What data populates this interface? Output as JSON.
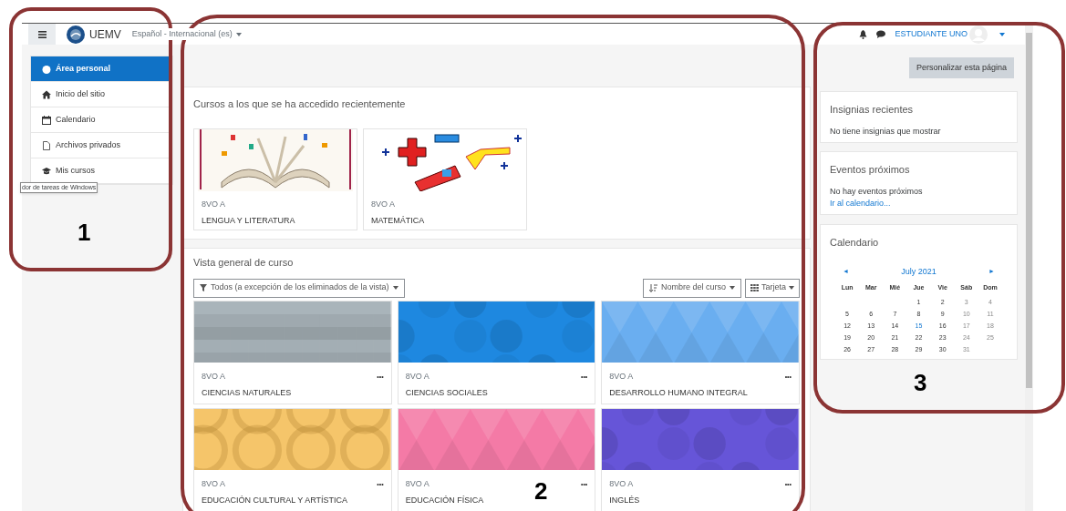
{
  "navbar": {
    "site_name": "UEMV",
    "language": "Español - Internacional (es)",
    "user_name": "ESTUDIANTE UNO"
  },
  "sidebar": {
    "items": [
      {
        "label": "Área personal",
        "kind": "dashboard",
        "selected": true
      },
      {
        "label": "Inicio del sitio",
        "kind": "home",
        "selected": false
      },
      {
        "label": "Calendario",
        "kind": "calendar",
        "selected": false
      },
      {
        "label": "Archivos privados",
        "kind": "file",
        "selected": false
      },
      {
        "label": "Mis cursos",
        "kind": "courses",
        "selected": false
      }
    ],
    "tooltip": "dor de tareas de Windows"
  },
  "recent_courses": {
    "title": "Cursos a los que se ha accedido recientemente",
    "courses": [
      {
        "category": "8VO A",
        "name": "LENGUA Y LITERATURA",
        "kind": "book"
      },
      {
        "category": "8VO A",
        "name": "MATEMÁTICA",
        "kind": "math"
      }
    ]
  },
  "course_overview": {
    "title": "Vista general de curso",
    "filter": "Todos (a excepción de los eliminados de la vista)",
    "sort": "Nombre del curso",
    "view": "Tarjeta",
    "menu_glyph": "•••",
    "courses": [
      {
        "category": "8VO A",
        "name": "CIENCIAS NATURALES",
        "color": "#a9b4ba",
        "kind": "squares"
      },
      {
        "category": "8VO A",
        "name": "CIENCIAS SOCIALES",
        "color": "#1e88e0",
        "kind": "octagons"
      },
      {
        "category": "8VO A",
        "name": "DESARROLLO HUMANO INTEGRAL",
        "color": "#6aaef0",
        "kind": "triangles"
      },
      {
        "category": "8VO A",
        "name": "EDUCACIÓN CULTURAL Y ARTÍSTICA",
        "color": "#f5c56a",
        "kind": "circles"
      },
      {
        "category": "8VO A",
        "name": "EDUCACIÓN FÍSICA",
        "color": "#f47aa6",
        "kind": "triangles"
      },
      {
        "category": "8VO A",
        "name": "INGLÉS",
        "color": "#6655d8",
        "kind": "octagons"
      }
    ]
  },
  "right_column": {
    "customize_button": "Personalizar esta página",
    "badges": {
      "title": "Insignias recientes",
      "text": "No tiene insignias que mostrar"
    },
    "events": {
      "title": "Eventos próximos",
      "text": "No hay eventos próximos",
      "link": "Ir al calendario..."
    },
    "calendar": {
      "title": "Calendario",
      "prev": "◄",
      "next": "►",
      "month": "July 2021",
      "weekdays": [
        "Lun",
        "Mar",
        "Mié",
        "Jue",
        "Vie",
        "Sáb",
        "Dom"
      ],
      "weeks": [
        {
          "kind": "first",
          "days": [
            {
              "day": "1",
              "today": false
            },
            {
              "day": "2",
              "today": false
            },
            {
              "day": "3",
              "today": false
            },
            {
              "day": "4",
              "today": false
            }
          ]
        },
        {
          "kind": "normal",
          "days": [
            {
              "day": "5",
              "today": false
            },
            {
              "day": "6",
              "today": false
            },
            {
              "day": "7",
              "today": false
            },
            {
              "day": "8",
              "today": false
            },
            {
              "day": "9",
              "today": false
            },
            {
              "day": "10",
              "today": false
            },
            {
              "day": "11",
              "today": false
            }
          ]
        },
        {
          "kind": "normal",
          "days": [
            {
              "day": "12",
              "today": false
            },
            {
              "day": "13",
              "today": false
            },
            {
              "day": "14",
              "today": false
            },
            {
              "day": "15",
              "today": true
            },
            {
              "day": "16",
              "today": false
            },
            {
              "day": "17",
              "today": false
            },
            {
              "day": "18",
              "today": false
            }
          ]
        },
        {
          "kind": "normal",
          "days": [
            {
              "day": "19",
              "today": false
            },
            {
              "day": "20",
              "today": false
            },
            {
              "day": "21",
              "today": false
            },
            {
              "day": "22",
              "today": false
            },
            {
              "day": "23",
              "today": false
            },
            {
              "day": "24",
              "today": false
            },
            {
              "day": "25",
              "today": false
            }
          ]
        },
        {
          "kind": "normal",
          "days": [
            {
              "day": "26",
              "today": false
            },
            {
              "day": "27",
              "today": false
            },
            {
              "day": "28",
              "today": false
            },
            {
              "day": "29",
              "today": false
            },
            {
              "day": "30",
              "today": false
            },
            {
              "day": "31",
              "today": false
            }
          ]
        }
      ]
    }
  },
  "annotations": [
    {
      "label": "1"
    },
    {
      "label": "2"
    },
    {
      "label": "3"
    }
  ]
}
